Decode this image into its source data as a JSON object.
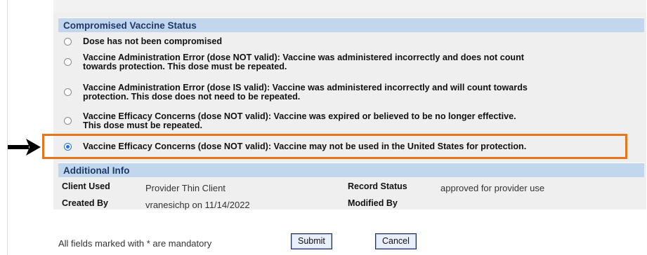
{
  "compromised": {
    "title": "Compromised Vaccine Status",
    "options": [
      {
        "line1": "Dose has not been compromised",
        "line2": "",
        "selected": false
      },
      {
        "line1": "Vaccine Administration Error (dose NOT valid): Vaccine was administered incorrectly and does not count",
        "line2": "towards protection. This dose must be repeated.",
        "selected": false
      },
      {
        "line1": "Vaccine Administration Error (dose IS valid): Vaccine was administered incorrectly and will count towards",
        "line2": "protection. This dose does not need to be repeated.",
        "selected": false
      },
      {
        "line1": "Vaccine Efficacy Concerns (dose NOT valid): Vaccine was expired or believed to be no longer effective.",
        "line2": "This dose must be repeated.",
        "selected": false
      },
      {
        "line1": "Vaccine Efficacy Concerns (dose NOT valid): Vaccine may not be used in the United States for protection.",
        "line2": "",
        "selected": true
      }
    ]
  },
  "additional": {
    "title": "Additional Info",
    "client_used_label": "Client Used",
    "client_used_value": "Provider Thin Client",
    "record_status_label": "Record Status",
    "record_status_value": "approved for provider use",
    "created_by_label": "Created By",
    "created_by_value": "vranesichp on 11/14/2022",
    "modified_by_label": "Modified By",
    "modified_by_value": ""
  },
  "footer": {
    "note": "All fields marked with * are mandatory",
    "submit_label": "Submit",
    "cancel_label": "Cancel"
  },
  "annotation": {
    "highlight_color": "#e7751b",
    "arrow_color": "#000000"
  }
}
